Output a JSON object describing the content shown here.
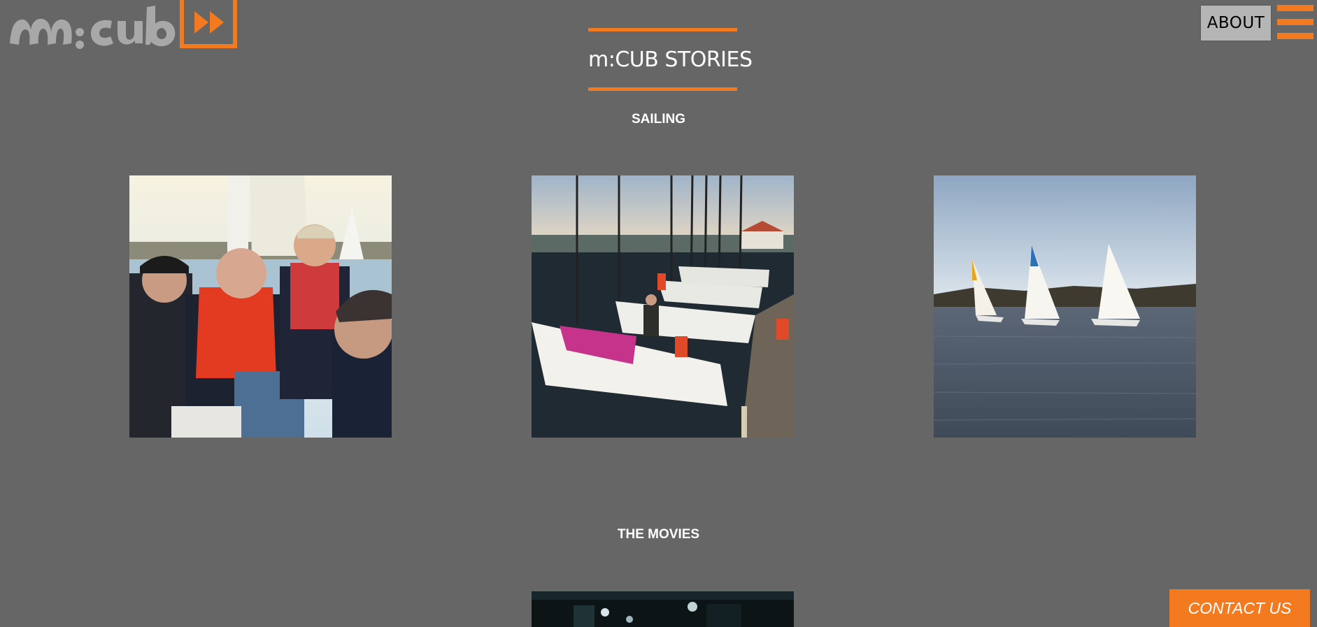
{
  "header": {
    "logo_text": "m:cub",
    "about_label": "ABOUT",
    "menu_icon": "hamburger-menu-icon"
  },
  "main": {
    "title": "m:CUB STORIES",
    "sections": [
      {
        "heading": "SAILING",
        "photos": [
          {
            "subject": "group selfie on sailboat"
          },
          {
            "subject": "sailboats moored at dock"
          },
          {
            "subject": "three sailboats on water"
          }
        ]
      },
      {
        "heading": "THE MOVIES",
        "photos": [
          {
            "subject": "dark cinema stage"
          }
        ]
      }
    ]
  },
  "footer": {
    "contact_label": "CONTACT US"
  },
  "colors": {
    "background": "#666666",
    "accent": "#f47a20",
    "about_button": "#b5b5b5",
    "text": "#ffffff"
  }
}
